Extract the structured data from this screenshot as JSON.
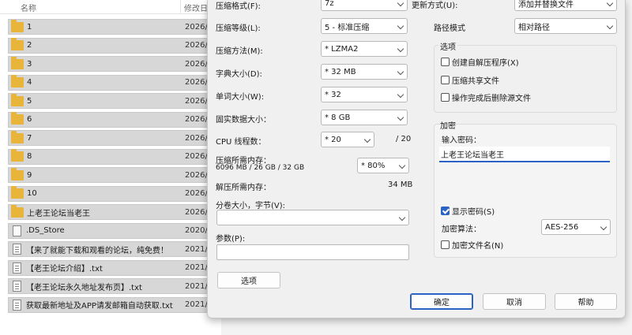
{
  "filelist": {
    "header_name": "名称",
    "header_modified": "修改日",
    "rows": [
      {
        "icon": "folder-icon",
        "name": "1",
        "date": "2026/"
      },
      {
        "icon": "folder-icon",
        "name": "2",
        "date": "2026/"
      },
      {
        "icon": "folder-icon",
        "name": "3",
        "date": "2026/"
      },
      {
        "icon": "folder-icon",
        "name": "4",
        "date": "2026/"
      },
      {
        "icon": "folder-icon",
        "name": "5",
        "date": "2026/"
      },
      {
        "icon": "folder-icon",
        "name": "6",
        "date": "2026/"
      },
      {
        "icon": "folder-icon",
        "name": "7",
        "date": "2026/"
      },
      {
        "icon": "folder-icon",
        "name": "8",
        "date": "2026/"
      },
      {
        "icon": "folder-icon",
        "name": "9",
        "date": "2026/"
      },
      {
        "icon": "folder-icon",
        "name": "10",
        "date": "2026/"
      },
      {
        "icon": "folder-icon",
        "name": "上老王论坛当老王",
        "date": "2026/"
      },
      {
        "icon": "file-icon",
        "name": ".DS_Store",
        "date": "2020/"
      },
      {
        "icon": "doc-icon",
        "name": "【来了就能下载和观看的论坛，纯免费！",
        "date": "2021/"
      },
      {
        "icon": "doc-icon",
        "name": "【老王论坛介绍】.txt",
        "date": "2021/"
      },
      {
        "icon": "doc-icon",
        "name": "【老王论坛永久地址发布页】.txt",
        "date": "2021/"
      },
      {
        "icon": "doc-icon",
        "name": "获取最新地址及APP请发邮箱自动获取.txt",
        "date": "2021/"
      }
    ]
  },
  "dialog": {
    "format_label": "压缩格式(F):",
    "format_value": "7z",
    "level_label": "压缩等级(L):",
    "level_value": "5 - 标准压缩",
    "method_label": "压缩方法(M):",
    "method_value": "* LZMA2",
    "dict_label": "字典大小(D):",
    "dict_value": "* 32 MB",
    "word_label": "单词大小(W):",
    "word_value": "* 32",
    "solid_label": "固实数据大小：",
    "solid_value": "* 8 GB",
    "cpu_label": "CPU 线程数：",
    "cpu_value": "* 20",
    "cpu_total": "/ 20",
    "mem_comp_label": "压缩所需内存：",
    "mem_comp_detail": "6096 MB / 26 GB / 32 GB",
    "mem_comp_value": "* 80%",
    "mem_decomp_label": "解压所需内存：",
    "mem_decomp_value": "34 MB",
    "split_label": "分卷大小，字节(V):",
    "split_value": "",
    "params_label": "参数(P):",
    "params_value": "",
    "options_button": "选项",
    "update_label": "更新方式(U):",
    "update_value": "添加并替换文件",
    "path_label": "路径模式",
    "path_value": "相对路径",
    "options_group_label": "选项",
    "opt_sfx": "创建自解压程序(X)",
    "opt_shared": "压缩共享文件",
    "opt_delete": "操作完成后删除源文件",
    "encrypt_group_label": "加密",
    "password_label": "输入密码：",
    "password_value": "上老王论坛当老王",
    "show_password": "显示密码(S)",
    "enc_method_label": "加密算法：",
    "enc_method_value": "AES-256",
    "enc_names": "加密文件名(N)",
    "ok_button": "确定",
    "cancel_button": "取消",
    "help_button": "帮助"
  }
}
